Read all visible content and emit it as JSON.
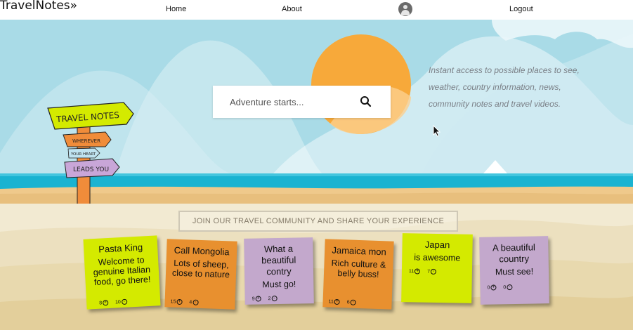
{
  "nav": {
    "logo": "TravelNotes",
    "logo_mark": "»",
    "home": "Home",
    "about": "About",
    "logout": "Logout"
  },
  "hero": {
    "search_placeholder": "Adventure starts...",
    "tagline": "Instant access to possible places to see, weather, country information, news, community notes and travel videos.",
    "sign": {
      "top": "TRAVEL NOTES",
      "a": "WHEREVER",
      "b": "YOUR HEART",
      "c": "LEADS YOU"
    }
  },
  "community": {
    "banner": "JOIN OUR TRAVEL COMMUNITY AND SHARE YOUR EXPERIENCE",
    "notes": [
      {
        "title": "Pasta King",
        "body": "Welcome to genuine Italian food, go there!",
        "up": "8",
        "down": "10",
        "color": "green"
      },
      {
        "title": "Call Mongolia",
        "body": "Lots of sheep, close to nature",
        "up": "15",
        "down": "4",
        "color": "orange"
      },
      {
        "title": "What a beautiful contry",
        "body": "Must go!",
        "up": "9",
        "down": "2",
        "color": "purple"
      },
      {
        "title": "Jamaica mon",
        "body": "Rich culture & belly buss!",
        "up": "11",
        "down": "6",
        "color": "orange"
      },
      {
        "title": "Japan",
        "body": "is awesome",
        "up": "11",
        "down": "7",
        "color": "green"
      },
      {
        "title": "A beautiful country",
        "body": "Must see!",
        "up": "0",
        "down": "0",
        "color": "purple"
      }
    ]
  },
  "colors": {
    "sky": "#9fd6e4",
    "sun": "#f7a93a",
    "sea": "#1ab3d1",
    "sand": "#efc98b",
    "note_green": "#d4ea00",
    "note_orange": "#e8902f",
    "note_purple": "#c3a8cc"
  }
}
